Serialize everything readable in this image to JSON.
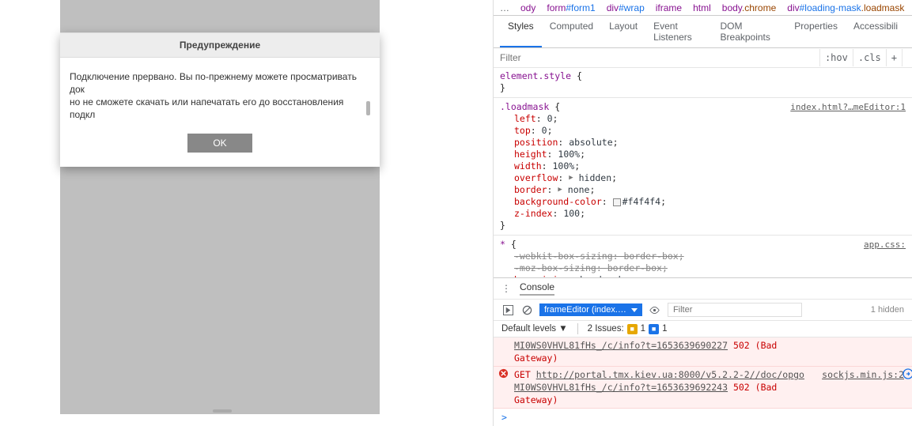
{
  "dialog": {
    "title": "Предупреждение",
    "body_line1": "Подключение прервано. Вы по-прежнему можете просматривать док",
    "body_line2": "но не сможете скачать или напечатать его до восстановления подкл",
    "ok": "OK"
  },
  "breadcrumb": {
    "ellipsis": "…",
    "items": [
      "ody",
      "form#form1",
      "div#wrap",
      "iframe",
      "html",
      "body.chrome",
      "div#loading-mask.loadmask"
    ]
  },
  "tabs": [
    "Styles",
    "Computed",
    "Layout",
    "Event Listeners",
    "DOM Breakpoints",
    "Properties",
    "Accessibili"
  ],
  "filter": {
    "placeholder": "Filter",
    "hov": ":hov",
    "cls": ".cls",
    "plus": "+"
  },
  "styles": {
    "element_style": "element.style",
    "loadmask": {
      "selector": ".loadmask",
      "link": "index.html?…meEditor:1",
      "props": [
        {
          "n": "left",
          "v": "0"
        },
        {
          "n": "top",
          "v": "0"
        },
        {
          "n": "position",
          "v": "absolute"
        },
        {
          "n": "height",
          "v": "100%"
        },
        {
          "n": "width",
          "v": "100%"
        },
        {
          "n": "overflow",
          "v": "hidden",
          "tri": true
        },
        {
          "n": "border",
          "v": "none",
          "tri": true
        },
        {
          "n": "background-color",
          "v": "#f4f4f4",
          "swatch": true
        },
        {
          "n": "z-index",
          "v": "100"
        }
      ]
    },
    "star": {
      "selector": "*",
      "link": "app.css:",
      "props": [
        {
          "n": "-webkit-box-sizing",
          "v": "border-box",
          "strike": true
        },
        {
          "n": "-moz-box-sizing",
          "v": "border-box",
          "strike": true
        },
        {
          "n": "box-sizing",
          "v": "border-box"
        }
      ]
    }
  },
  "console": {
    "title": "Console",
    "context": "frameEditor (index.…",
    "filter_placeholder": "Filter",
    "hidden": "1 hidden",
    "default_levels": "Default levels ▼",
    "issues_label": "2 Issues:",
    "issue_y": "1",
    "issue_b": "1",
    "msgs": [
      {
        "line1_link": "MI0WS0VHVL81fHs_/c/info?t=1653639690227",
        "line1_rest": " 502 (Bad",
        "line2": "Gateway)"
      },
      {
        "pre": "GET ",
        "url": "http://portal.tmx.kiev.ua:8000/v5.2.2-2//doc/opgo",
        "src": "sockjs.min.js:2",
        "line2_link": "MI0WS0VHVL81fHs_/c/info?t=1653639692243",
        "line2_rest": " 502 (Bad",
        "line3": "Gateway)"
      }
    ],
    "prompt": ">"
  }
}
